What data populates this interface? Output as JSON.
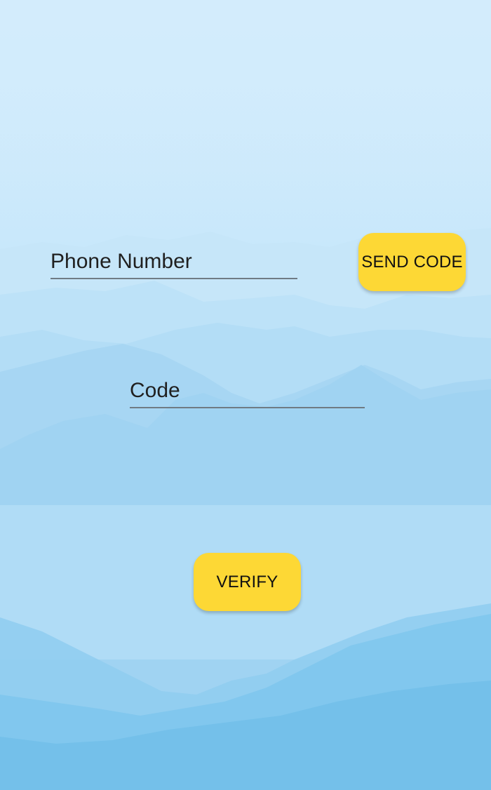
{
  "form": {
    "phone_placeholder": "Phone Number",
    "phone_value": "",
    "code_placeholder": "Code",
    "code_value": ""
  },
  "buttons": {
    "send_code_label": "SEND CODE",
    "verify_label": "VERIFY"
  },
  "colors": {
    "button": "#fdd835",
    "underline": "#6f7b84",
    "background_top": "#d2ecfc",
    "background_bottom": "#9fd3f1"
  },
  "background": {
    "image": "misty-mountains"
  }
}
